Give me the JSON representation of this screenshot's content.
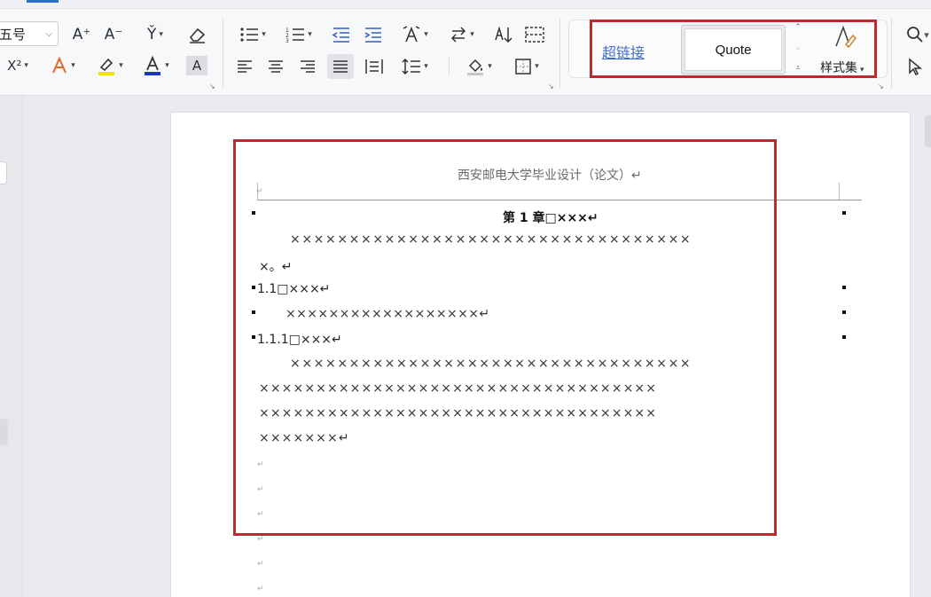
{
  "ribbon": {
    "font_size_value": "五号",
    "grow_font_label": "A⁺",
    "shrink_font_label": "A⁻",
    "phonetic_label": "Y̌",
    "superscript_label": "X²",
    "highlight_color": "#f2e200",
    "font_color": "#1f35c0",
    "char_shading_label": "A",
    "styles": {
      "hyperlink_label": "超链接",
      "quote_label": "Quote",
      "style_set_label": "样式集"
    }
  },
  "document": {
    "header_text": "西安邮电大学毕业设计（论文）↵",
    "chapter_heading": "第 1 章□×××↵",
    "para1_line1": "××××××××××××××××××××××××××××××××××",
    "para1_line2": "×。↵",
    "section_1_1": "1.1□×××↵",
    "section_1_1_body": "××××××××××××××××××↵",
    "section_1_1_1": "1.1.1□×××↵",
    "para2_line1": "××××××××××××××××××××××××××××××××××",
    "para2_line2": "×××××××××××××××××××××××××××××××××××",
    "para2_line3": "×××××××××××××××××××××××××××××××××××",
    "para2_line4": "×××××××↵",
    "empty_mark": "↵"
  }
}
